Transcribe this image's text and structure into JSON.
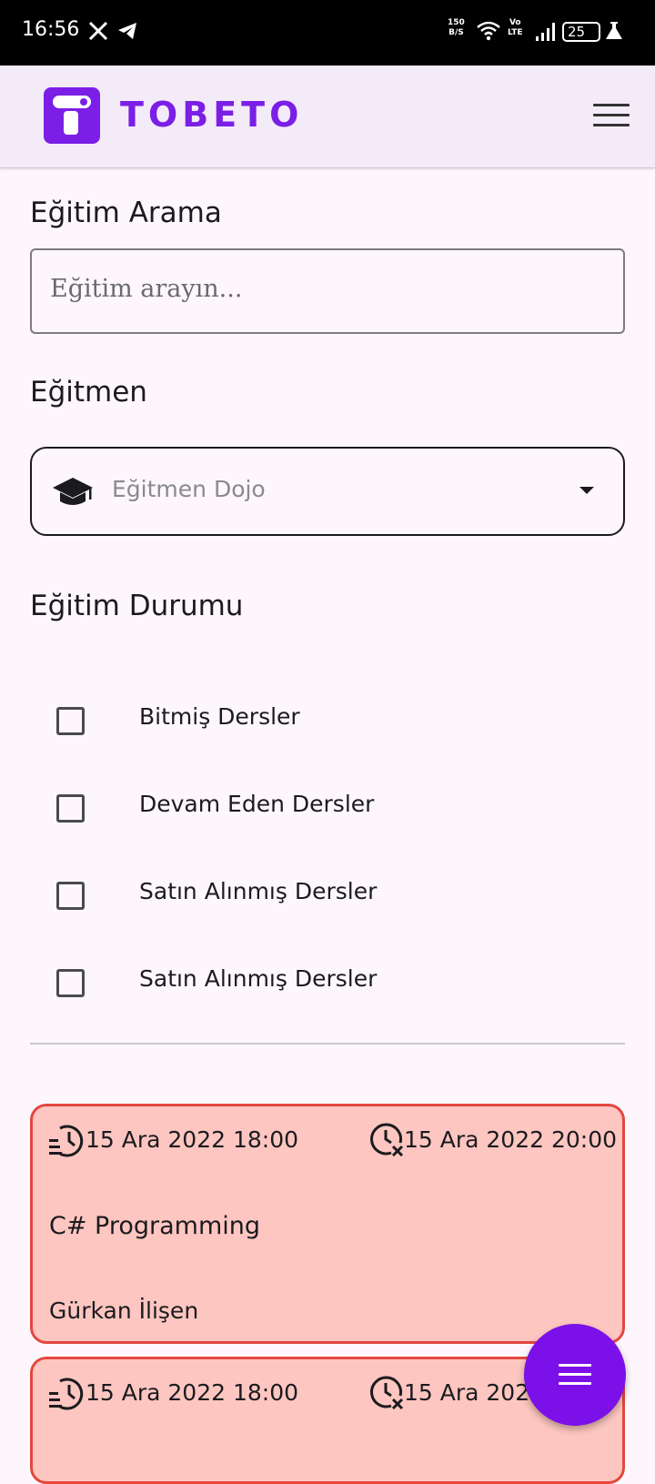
{
  "status_bar": {
    "time": "16:56",
    "net_speed_value": "150",
    "net_speed_unit": "B/S",
    "volte_top": "Vo",
    "volte_bottom": "LTE",
    "battery": "25"
  },
  "app_bar": {
    "logo_text": "TOBETO",
    "brand_color": "#7b1fe6"
  },
  "search": {
    "label": "Eğitim Arama",
    "placeholder": "Eğitim arayın...",
    "value": ""
  },
  "instructor_filter": {
    "label": "Eğitmen",
    "selected": "Eğitmen Dojo",
    "icon": "graduation-cap-icon"
  },
  "status_filter": {
    "label": "Eğitim Durumu",
    "options": [
      {
        "label": "Bitmiş Dersler",
        "checked": false
      },
      {
        "label": "Devam Eden Dersler",
        "checked": false
      },
      {
        "label": "Satın Alınmış Dersler",
        "checked": false
      },
      {
        "label": "Satın Alınmış Dersler",
        "checked": false
      }
    ]
  },
  "courses": [
    {
      "start": "15 Ara 2022 18:00",
      "end": "15 Ara 2022 20:00",
      "title": "C# Programming",
      "instructor": "Gürkan İlişen",
      "background": "#fec6c0",
      "border": "#e4473e"
    },
    {
      "start": "15 Ara 2022 18:00",
      "end": "15 Ara 2022 20:00",
      "title": "",
      "instructor": "",
      "background": "#fec6c0",
      "border": "#e4473e"
    }
  ],
  "fab": {
    "icon": "menu-icon",
    "color": "#7b10e8"
  }
}
